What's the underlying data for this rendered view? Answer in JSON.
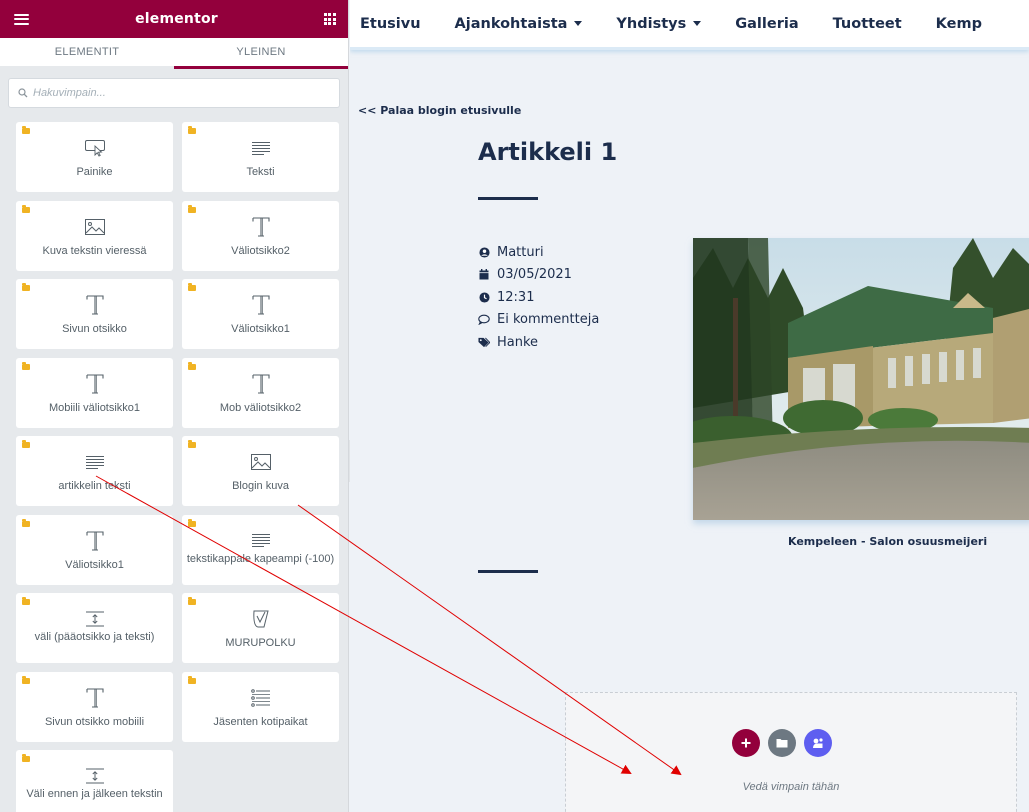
{
  "panel": {
    "logo": "elementor",
    "tabs": [
      {
        "label": "ELEMENTIT",
        "active": false
      },
      {
        "label": "YLEINEN",
        "active": true
      }
    ],
    "search_placeholder": "Hakuvimpain...",
    "widgets": [
      {
        "label": "Painike",
        "icon": "button-icon"
      },
      {
        "label": "Teksti",
        "icon": "text-lines-icon"
      },
      {
        "label": "Kuva tekstin vieressä",
        "icon": "image-icon"
      },
      {
        "label": "Väliotsikko2",
        "icon": "heading-t-icon"
      },
      {
        "label": "Sivun otsikko",
        "icon": "heading-t-icon"
      },
      {
        "label": "Väliotsikko1",
        "icon": "heading-t-icon"
      },
      {
        "label": "Mobiili väliotsikko1",
        "icon": "heading-t-icon"
      },
      {
        "label": "Mob väliotsikko2",
        "icon": "heading-t-icon"
      },
      {
        "label": "artikkelin teksti",
        "icon": "text-lines-icon"
      },
      {
        "label": "Blogin kuva",
        "icon": "image-icon"
      },
      {
        "label": "Väliotsikko1",
        "icon": "heading-t-icon"
      },
      {
        "label": "tekstikappale kapeampi (-100)",
        "icon": "text-lines-icon"
      },
      {
        "label": "väli (pääotsikko ja teksti)",
        "icon": "spacer-icon"
      },
      {
        "label": "MURUPOLKU",
        "icon": "breadcrumbs-icon"
      },
      {
        "label": "Sivun otsikko mobiili",
        "icon": "heading-t-icon"
      },
      {
        "label": "Jäsenten kotipaikat",
        "icon": "list-icon"
      },
      {
        "label": "Väli ennen ja jälkeen tekstin",
        "icon": "spacer-icon"
      }
    ]
  },
  "site": {
    "nav": [
      {
        "label": "Etusivu",
        "dropdown": false
      },
      {
        "label": "Ajankohtaista",
        "dropdown": true
      },
      {
        "label": "Yhdistys",
        "dropdown": true
      },
      {
        "label": "Galleria",
        "dropdown": false
      },
      {
        "label": "Tuotteet",
        "dropdown": false
      },
      {
        "label": "Kemp",
        "dropdown": false
      }
    ],
    "back_link": "<< Palaa blogin etusivulle",
    "post_title": "Artikkeli 1",
    "meta": {
      "author": "Matturi",
      "date": "03/05/2021",
      "time": "12:31",
      "comments": "Ei kommentteja",
      "category": "Hanke"
    },
    "image_caption": "Kempeleen - Salon osuusmeijeri",
    "drop_zone_text": "Vedä vimpain tähän"
  },
  "colors": {
    "elementor_brand": "#93003c",
    "navy": "#1c2d4c",
    "folder": "#f0b323",
    "add_button": "#93003c",
    "template_button": "#6d7882",
    "kit_button": "#5e5ef0",
    "annotation_arrow": "#e00000"
  }
}
